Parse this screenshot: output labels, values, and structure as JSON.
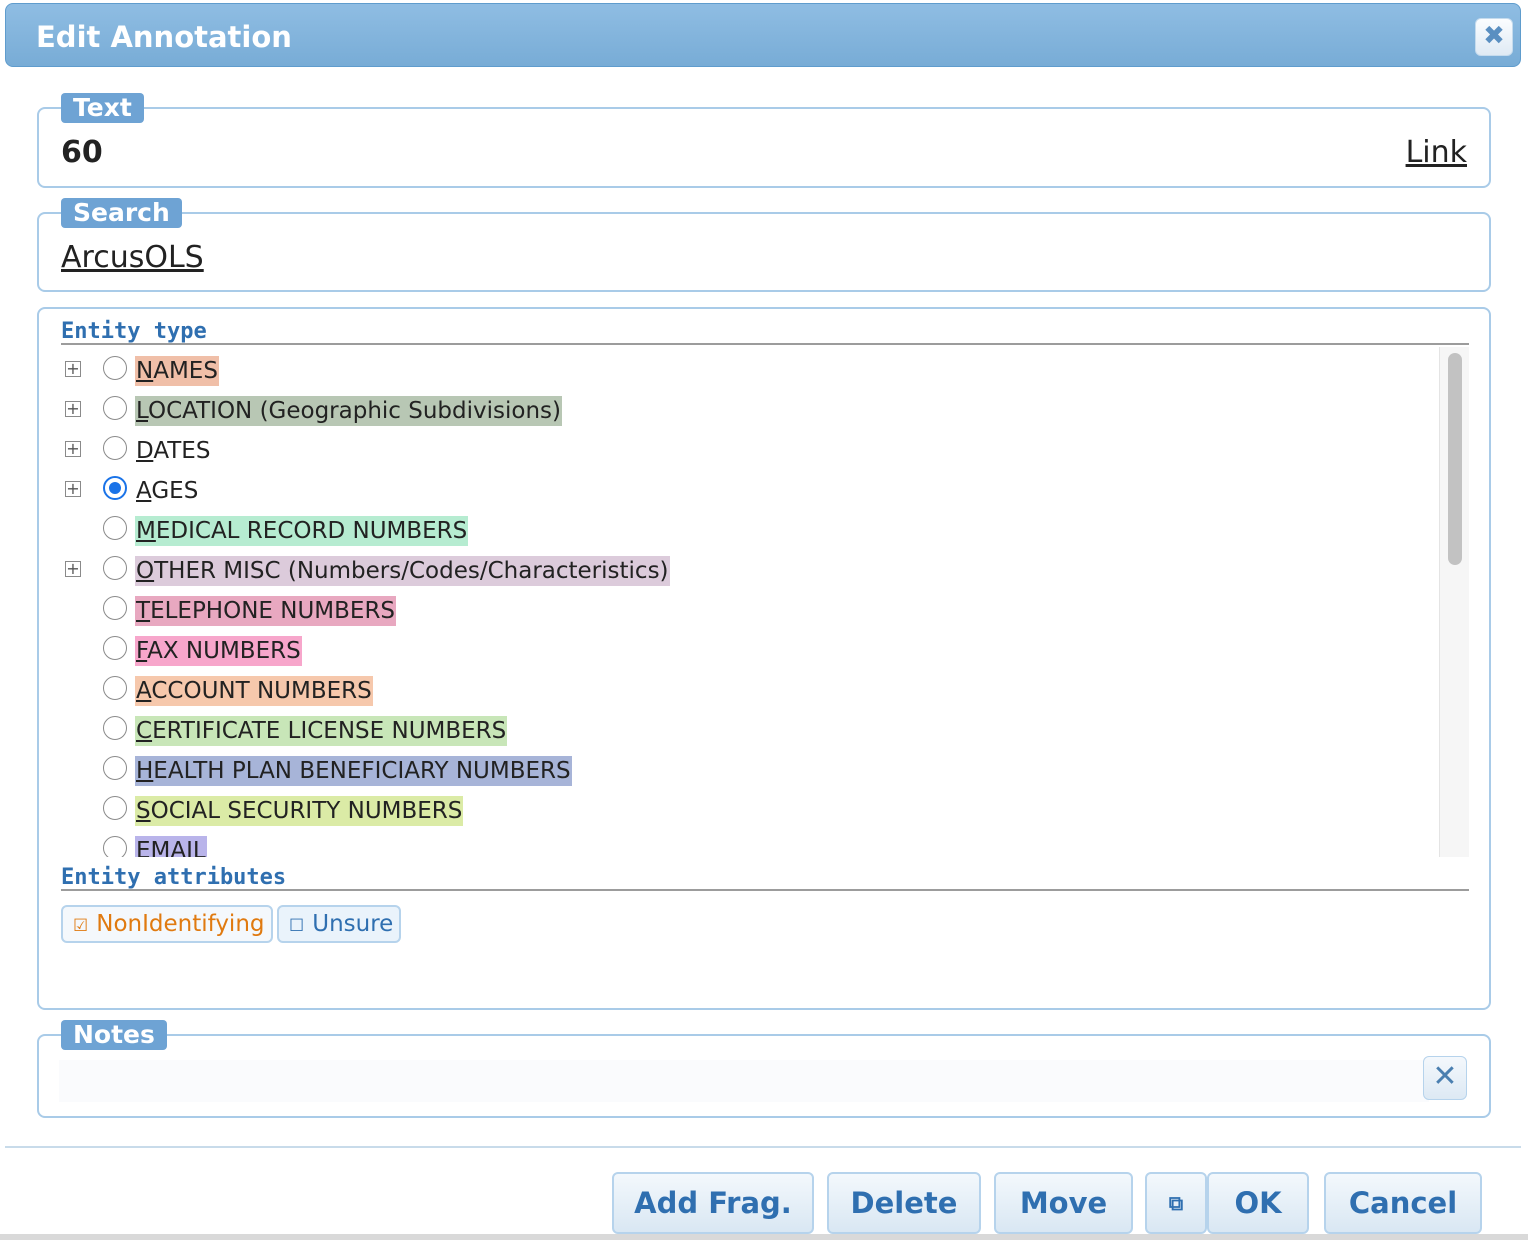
{
  "dialog": {
    "title": "Edit Annotation",
    "close_glyph": "✖"
  },
  "text_section": {
    "legend": "Text",
    "value": "60",
    "link_label": "Link"
  },
  "search_section": {
    "legend": "Search",
    "link_label": "ArcusOLS"
  },
  "entity_type": {
    "heading": "Entity type",
    "expander_glyph": "+",
    "items": [
      {
        "label": "NAMES",
        "color": "#f0bfa8",
        "expandable": true,
        "checked": false
      },
      {
        "label": "LOCATION (Geographic Subdivisions)",
        "color": "#b8c7b4",
        "expandable": true,
        "checked": false
      },
      {
        "label": "DATES",
        "color": "",
        "expandable": true,
        "checked": false
      },
      {
        "label": "AGES",
        "color": "",
        "expandable": true,
        "checked": true
      },
      {
        "label": "MEDICAL RECORD NUMBERS",
        "color": "#b6ecd1",
        "expandable": false,
        "checked": false
      },
      {
        "label": "OTHER MISC (Numbers/Codes/Characteristics)",
        "color": "#dccbdb",
        "expandable": true,
        "checked": false
      },
      {
        "label": "TELEPHONE NUMBERS",
        "color": "#e8a8c0",
        "expandable": false,
        "checked": false
      },
      {
        "label": "FAX NUMBERS",
        "color": "#f7a6cb",
        "expandable": false,
        "checked": false
      },
      {
        "label": "ACCOUNT NUMBERS",
        "color": "#f6c8ac",
        "expandable": false,
        "checked": false
      },
      {
        "label": "CERTIFICATE LICENSE NUMBERS",
        "color": "#c8e6b8",
        "expandable": false,
        "checked": false
      },
      {
        "label": "HEALTH PLAN BENEFICIARY NUMBERS",
        "color": "#a7b4d8",
        "expandable": false,
        "checked": false
      },
      {
        "label": "SOCIAL SECURITY NUMBERS",
        "color": "#dbeba6",
        "expandable": false,
        "checked": false
      },
      {
        "label": "EMAIL",
        "color": "#b9b4ea",
        "expandable": false,
        "checked": false
      }
    ]
  },
  "entity_attributes": {
    "heading": "Entity attributes",
    "items": [
      {
        "label": "NonIdentifying",
        "glyph": "☑",
        "checked": true,
        "color": "#e07a10"
      },
      {
        "label": "Unsure",
        "glyph": "☐",
        "checked": false,
        "color": "#2f6fb0"
      }
    ]
  },
  "notes_section": {
    "legend": "Notes",
    "value": "",
    "clear_glyph": "✕"
  },
  "footer": {
    "add_frag": "Add Frag.",
    "delete": "Delete",
    "move": "Move",
    "lock_glyph": "⧉",
    "ok": "OK",
    "cancel": "Cancel"
  }
}
